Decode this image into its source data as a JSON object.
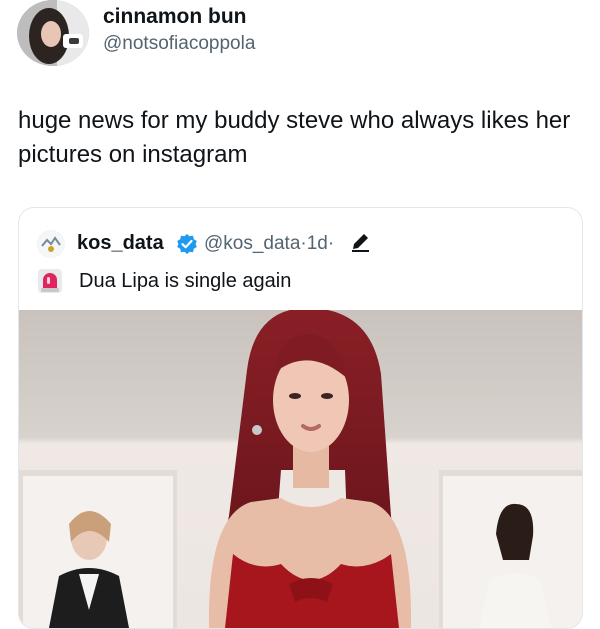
{
  "tweet": {
    "display_name": "cinnamon bun",
    "handle": "@notsofiacoppola",
    "text": "huge news for my buddy steve who always likes her pictures on instagram"
  },
  "quoted": {
    "display_name": "kos_data",
    "handle": "@kos_data",
    "separator_1": "·",
    "age": "1d",
    "separator_2": "·",
    "text": "Dua Lipa is single again",
    "icons": [
      "avatar-logo",
      "verified-badge-icon",
      "edit-pencil-icon",
      "siren-emoji-icon"
    ]
  },
  "colors": {
    "text_primary": "#0f1419",
    "text_secondary": "#536471",
    "verified_blue": "#1d9bf0",
    "border": "#e3e7ea"
  }
}
